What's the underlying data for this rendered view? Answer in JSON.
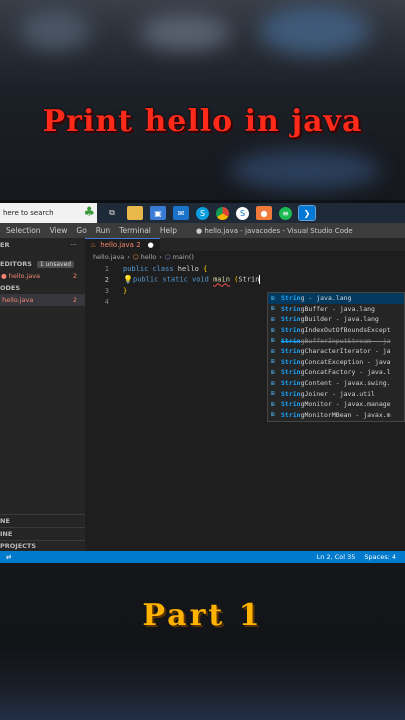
{
  "headline": "Print hello in java",
  "footer_caption": "Part 1",
  "taskbar": {
    "search_placeholder": "here to search",
    "icons": [
      "task-view-icon",
      "file-explorer-icon",
      "store-icon",
      "mail-icon",
      "skype-icon",
      "chrome-icon",
      "skype-alt-icon",
      "paint-icon",
      "spotify-icon",
      "vscode-icon"
    ]
  },
  "menubar": {
    "items": [
      "Selection",
      "View",
      "Go",
      "Run",
      "Terminal",
      "Help"
    ],
    "window_title": "● hello.java - javacodes - Visual Studio Code"
  },
  "sidebar": {
    "header": "ER",
    "more": "···",
    "open_editors_label": "EDITORS",
    "unsaved_badge": "1 unsaved",
    "open_file": "hello.java",
    "open_file_count": "2",
    "folder_label": "ODES",
    "folder_file": "hello.java",
    "folder_file_count": "2",
    "bottom_sections": [
      "NE",
      "INE",
      "PROJECTS"
    ]
  },
  "editor": {
    "tab_label": "hello.java 2",
    "tab_dot": "●",
    "breadcrumb": [
      "hello.java",
      "hello",
      "main()"
    ],
    "lines": [
      {
        "n": "1",
        "text": "public class hello {"
      },
      {
        "n": "2",
        "text": "public static void main (Strin"
      },
      {
        "n": "3",
        "text": "}"
      },
      {
        "n": "4",
        "text": ""
      }
    ]
  },
  "suggestions": [
    {
      "match": "Strin",
      "rest": "g - java.lang"
    },
    {
      "match": "Strin",
      "rest": "gBuffer - java.lang"
    },
    {
      "match": "Strin",
      "rest": "gBuilder - java.lang"
    },
    {
      "match": "Strin",
      "rest": "gIndexOutOfBoundsExcept"
    },
    {
      "match": "Strin",
      "rest": "gBufferInputStream - ja"
    },
    {
      "match": "Strin",
      "rest": "gCharacterIterator - ja"
    },
    {
      "match": "Strin",
      "rest": "gConcatException - java"
    },
    {
      "match": "Strin",
      "rest": "gConcatFactory - java.l"
    },
    {
      "match": "Strin",
      "rest": "gContent - javax.swing."
    },
    {
      "match": "Strin",
      "rest": "gJoiner - java.util"
    },
    {
      "match": "Strin",
      "rest": "gMonitor - javax.manage"
    },
    {
      "match": "Strin",
      "rest": "gMonitorMBean - javax.m"
    }
  ],
  "statusbar": {
    "remote": "⇄",
    "position": "Ln 2, Col 35",
    "spaces": "Spaces: 4"
  },
  "colors": {
    "headline": "#ff2a1a",
    "footer": "#ffb300",
    "statusbar": "#007acc",
    "error": "#f48771"
  }
}
